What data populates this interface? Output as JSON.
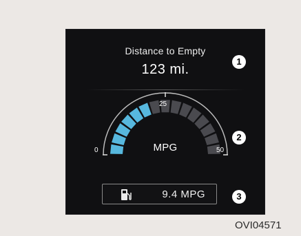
{
  "distance": {
    "title": "Distance to Empty",
    "value": "123 mi."
  },
  "gauge": {
    "min_label": "0",
    "mid_label": "25",
    "max_label": "50",
    "unit": "MPG",
    "fill_fraction": 0.4,
    "segment_count": 15,
    "fill_color": "#57b8de",
    "empty_color": "#4a4a4f"
  },
  "average": {
    "icon": "fuel-pump-icon",
    "value": "9.4 MPG"
  },
  "callouts": {
    "one": "1",
    "two": "2",
    "three": "3"
  },
  "figure_code": "OVI04571"
}
